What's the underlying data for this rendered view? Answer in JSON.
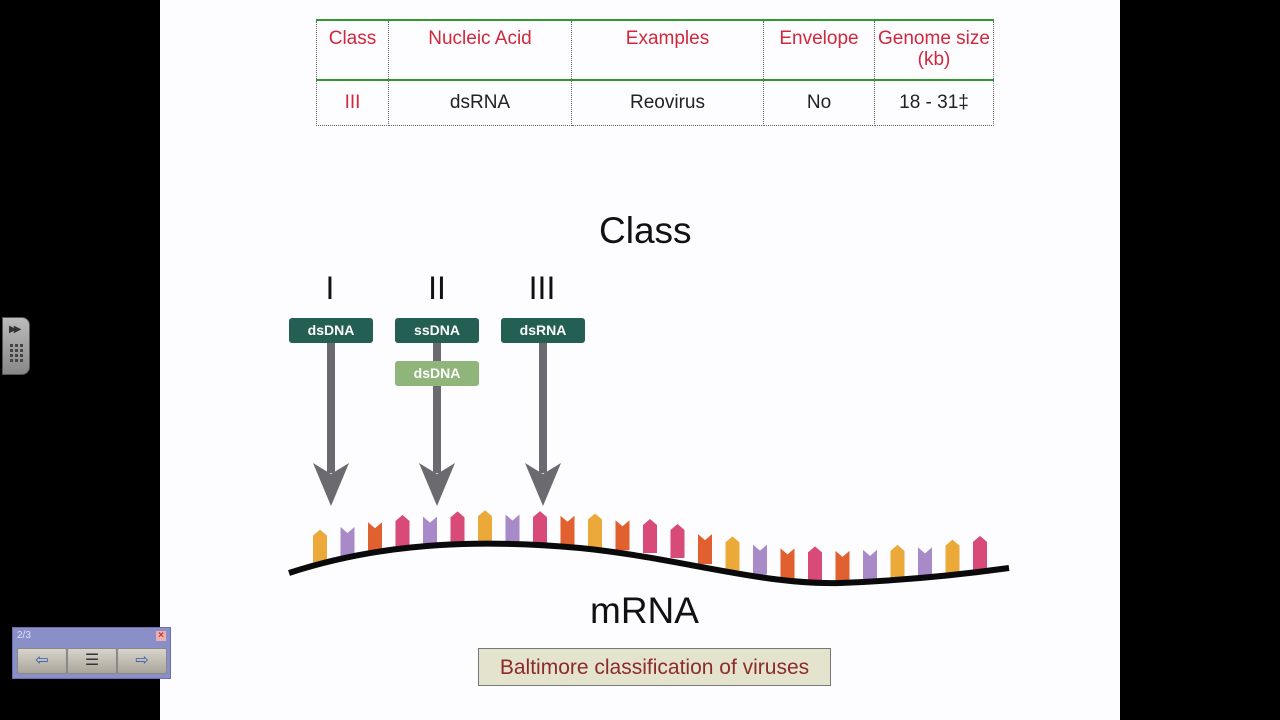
{
  "table": {
    "headers": [
      "Class",
      "Nucleic Acid",
      "Examples",
      "Envelope",
      "Genome size (kb)"
    ],
    "rows": [
      [
        "III",
        "dsRNA",
        "Reovirus",
        "No",
        "18 - 31‡"
      ]
    ]
  },
  "diagram": {
    "title": "Class",
    "classes": [
      {
        "numeral": "I",
        "boxes": [
          {
            "label": "dsDNA",
            "shade": "dark"
          }
        ]
      },
      {
        "numeral": "II",
        "boxes": [
          {
            "label": "ssDNA",
            "shade": "dark"
          },
          {
            "label": "dsDNA",
            "shade": "light"
          }
        ]
      },
      {
        "numeral": "III",
        "boxes": [
          {
            "label": "dsRNA",
            "shade": "dark"
          }
        ]
      }
    ],
    "target_label": "mRNA",
    "bases": [
      "orange",
      "purple",
      "red",
      "pink",
      "purple",
      "pink",
      "orange",
      "purple",
      "pink",
      "red",
      "orange",
      "red",
      "pink",
      "pink",
      "red",
      "orange",
      "purple",
      "red",
      "pink",
      "red",
      "purple",
      "orange",
      "purple",
      "orange",
      "pink"
    ],
    "base_colors": {
      "orange": "#eba93a",
      "purple": "#a98ac8",
      "red": "#e0612f",
      "pink": "#d84a78"
    },
    "box_colors": {
      "dark": "#245f54",
      "light": "#8fb57a"
    },
    "arrow_color": "#6b6a70"
  },
  "caption": "Baltimore classification of viruses",
  "player": {
    "slide_counter": "2/3",
    "prev_icon": "arrow-left-icon",
    "menu_icon": "slide-list-icon",
    "next_icon": "arrow-right-icon",
    "close_icon": "close-icon"
  }
}
